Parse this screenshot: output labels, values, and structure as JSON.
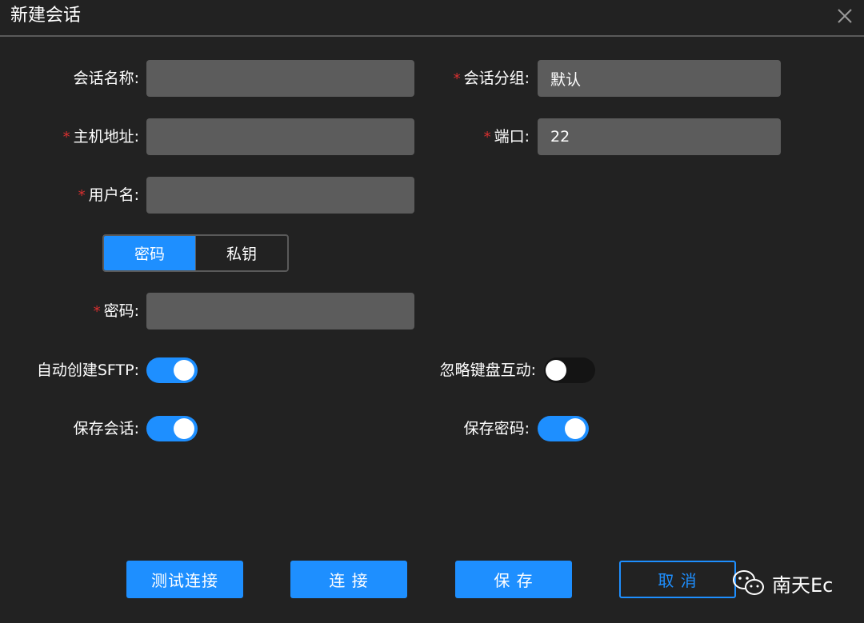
{
  "window": {
    "title": "新建会话"
  },
  "form": {
    "session_name": {
      "label": "会话名称:",
      "value": "",
      "required": false
    },
    "session_group": {
      "label": "会话分组:",
      "value": "默认",
      "required": true
    },
    "host": {
      "label": "主机地址:",
      "value": "",
      "required": true
    },
    "port": {
      "label": "端口:",
      "value": "22",
      "required": true
    },
    "username": {
      "label": "用户名:",
      "value": "",
      "required": true
    },
    "auth_tabs": [
      {
        "label": "密码",
        "active": true
      },
      {
        "label": "私钥",
        "active": false
      }
    ],
    "password": {
      "label": "密码:",
      "value": "",
      "required": true
    },
    "required_mark": "*"
  },
  "toggles": {
    "auto_sftp": {
      "label": "自动创建SFTP:",
      "on": true
    },
    "ignore_keyboard": {
      "label": "忽略键盘互动:",
      "on": false
    },
    "save_session": {
      "label": "保存会话:",
      "on": true
    },
    "save_password": {
      "label": "保存密码:",
      "on": true
    }
  },
  "buttons": {
    "test": "测试连接",
    "connect": "连 接",
    "save": "保 存",
    "cancel": "取 消"
  },
  "watermark": {
    "text": "南天Ec",
    "icon": "wechat-icon"
  },
  "colors": {
    "accent": "#1e8fff",
    "required": "#d93030",
    "background": "#222222",
    "input": "#5c5c5c"
  }
}
